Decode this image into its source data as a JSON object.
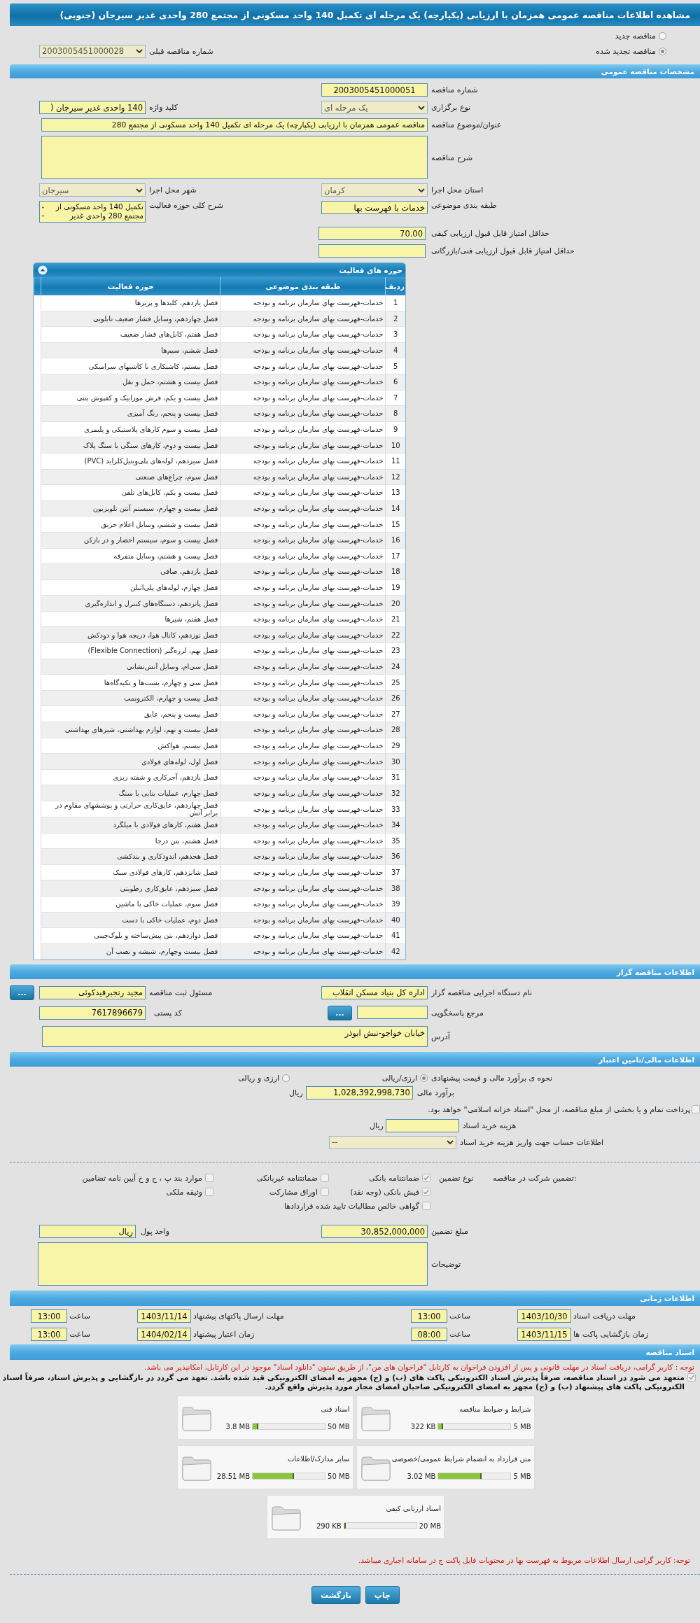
{
  "title": "مشاهده اطلاعات مناقصه عمومی همزمان با ارزیابی (یکپارچه) یک مرحله ای تکمیل 140 واحد مسکونی از مجتمع 280 واحدی غدیر سیرجان (جنوبی)",
  "tender_options": [
    {
      "label": "مناقصه جدید",
      "selected": false
    },
    {
      "label": "مناقصه تجدید شده",
      "selected": true
    }
  ],
  "previous_tender": {
    "label": "شماره مناقصه قبلی",
    "value": "2003005451000028"
  },
  "general": {
    "heading": "مشخصات مناقصه عمومی",
    "tender_number": {
      "label": "شماره مناقصه",
      "value": "2003005451000051"
    },
    "holding_type": {
      "label": "نوع برگزاری",
      "value": "یک مرحله ای"
    },
    "keyword": {
      "label": "کلید واژه",
      "value": "140 واحدی غدیر سیرجان ("
    },
    "subject": {
      "label": "عنوان/موضوع مناقصه",
      "value": "مناقصه عمومی همزمان با ارزیابی (یکپارچه) یک مرحله ای تکمیل 140 واحد مسکونی از مجتمع 280"
    },
    "description": {
      "label": "شرح مناقصه"
    },
    "province": {
      "label": "استان محل اجرا",
      "value": "کرمان"
    },
    "city": {
      "label": "شهر محل اجرا",
      "value": "سیرجان"
    },
    "category": {
      "label": "طبقه بندی موضوعی",
      "value": "خدمات با فهرست بها"
    },
    "activity_summary": {
      "label": "شرح کلی حوزه فعالیت",
      "value": "تکمیل 140 واحد مسکونی از مجتمع 280 واحدی غدیر"
    },
    "min_quality": {
      "label": "حداقل امتیاز قابل قبول ارزیابی کیفی",
      "value": "70.00"
    },
    "min_technical": {
      "label": "حداقل امتیاز قابل قبول ارزیابی فنی/بازرگانی"
    }
  },
  "activities": {
    "heading": "حوزه های فعالیت",
    "columns": [
      "ردیف",
      "طبقه بندی موضوعی",
      "حوزه فعالیت"
    ],
    "rows": [
      {
        "no": "1",
        "category": "خدمات-فهرست بهای سازمان برنامه و بودجه",
        "activity": "فصل یازدهم، کلیدها و پریزها"
      },
      {
        "no": "2",
        "category": "خدمات-فهرست بهای سازمان برنامه و بودجه",
        "activity": "فصل چهاردهم، وسایل فشار ضعیف تابلویی"
      },
      {
        "no": "3",
        "category": "خدمات-فهرست بهای سازمان برنامه و بودجه",
        "activity": "فصل هفتم، کابل‌های فشار ضعیف"
      },
      {
        "no": "4",
        "category": "خدمات-فهرست بهای سازمان برنامه و بودجه",
        "activity": "فصل ششم، سیم‌ها"
      },
      {
        "no": "5",
        "category": "خدمات-فهرست بهای سازمان برنامه و بودجه",
        "activity": "فصل بیستم، کاشیکاری با کاشیهای سرامیکی"
      },
      {
        "no": "6",
        "category": "خدمات-فهرست بهای سازمان برنامه و بودجه",
        "activity": "فصل بیست و هشتم، حمل و نقل"
      },
      {
        "no": "7",
        "category": "خدمات-فهرست بهای سازمان برنامه و بودجه",
        "activity": "فصل بیست و یکم، فرش موزاییک و کفپوش بتنی"
      },
      {
        "no": "8",
        "category": "خدمات-فهرست بهای سازمان برنامه و بودجه",
        "activity": "فصل بیست و پنجم، رنگ آمیزی"
      },
      {
        "no": "9",
        "category": "خدمات-فهرست بهای سازمان برنامه و بودجه",
        "activity": "فصل بیست و سوم کارهای پلاستیکی و پلیمری"
      },
      {
        "no": "10",
        "category": "خدمات-فهرست بهای سازمان برنامه و بودجه",
        "activity": "فصل بیست و دوم، کارهای سنگی با سنگ پلاک"
      },
      {
        "no": "11",
        "category": "خدمات-فهرست بهای سازمان برنامه و بودجه",
        "activity": "فصل سیزدهم، لوله‌های پلی‌وینیل‌کلراید (PVC)"
      },
      {
        "no": "12",
        "category": "خدمات-فهرست بهای سازمان برنامه و بودجه",
        "activity": "فصل سوم، چراغ‌های صنعتی"
      },
      {
        "no": "13",
        "category": "خدمات-فهرست بهای سازمان برنامه و بودجه",
        "activity": "فصل بیست و یکم، کابل‌های تلفن"
      },
      {
        "no": "14",
        "category": "خدمات-فهرست بهای سازمان برنامه و بودجه",
        "activity": "فصل بیست و چهارم، سیستم آنتن تلویزیون"
      },
      {
        "no": "15",
        "category": "خدمات-فهرست بهای سازمان برنامه و بودجه",
        "activity": "فصل بیست و ششم، وسایل اعلام حریق"
      },
      {
        "no": "16",
        "category": "خدمات-فهرست بهای سازمان برنامه و بودجه",
        "activity": "فصل بیست و سوم، سیستم احضار و در بازکن"
      },
      {
        "no": "17",
        "category": "خدمات-فهرست بهای سازمان برنامه و بودجه",
        "activity": "فصل بیست و هشتم، وسایل متفرقه"
      },
      {
        "no": "18",
        "category": "خدمات-فهرست بهای سازمان برنامه و بودجه",
        "activity": "فصل یازدهم، صافی"
      },
      {
        "no": "19",
        "category": "خدمات-فهرست بهای سازمان برنامه و بودجه",
        "activity": "فصل چهارم، لوله‌های پلی‌اتیلن"
      },
      {
        "no": "20",
        "category": "خدمات-فهرست بهای سازمان برنامه و بودجه",
        "activity": "فصل پانزدهم، دستگاه‌های کنترل و اندازه‌گیری"
      },
      {
        "no": "21",
        "category": "خدمات-فهرست بهای سازمان برنامه و بودجه",
        "activity": "فصل هفتم، شیرها"
      },
      {
        "no": "22",
        "category": "خدمات-فهرست بهای سازمان برنامه و بودجه",
        "activity": "فصل نوزدهم، کانال هوا، دریچه هوا و دودکش"
      },
      {
        "no": "23",
        "category": "خدمات-فهرست بهای سازمان برنامه و بودجه",
        "activity": "فصل نهم، لرزه‌گیر (Flexible Connection)"
      },
      {
        "no": "24",
        "category": "خدمات-فهرست بهای سازمان برنامه و بودجه",
        "activity": "فصل سی‌ام، وسایل آتش‌نشانی"
      },
      {
        "no": "25",
        "category": "خدمات-فهرست بهای سازمان برنامه و بودجه",
        "activity": "فصل سی و چهارم، بست‌ها و تکیه‌گاه‌ها"
      },
      {
        "no": "26",
        "category": "خدمات-فهرست بهای سازمان برنامه و بودجه",
        "activity": "فصل بیست و چهارم، الکتروپمپ"
      },
      {
        "no": "27",
        "category": "خدمات-فهرست بهای سازمان برنامه و بودجه",
        "activity": "فصل بیست و پنجم، عایق"
      },
      {
        "no": "28",
        "category": "خدمات-فهرست بهای سازمان برنامه و بودجه",
        "activity": "فصل بیست و نهم، لوازم بهداشتی، شیرهای بهداشتی"
      },
      {
        "no": "29",
        "category": "خدمات-فهرست بهای سازمان برنامه و بودجه",
        "activity": "فصل بیستم، هواکش"
      },
      {
        "no": "30",
        "category": "خدمات-فهرست بهای سازمان برنامه و بودجه",
        "activity": "فصل اول، لوله‌های فولادی"
      },
      {
        "no": "31",
        "category": "خدمات-فهرست بهای سازمان برنامه و بودجه",
        "activity": "فصل یازدهم، آجرکاری و شفته ریزی"
      },
      {
        "no": "32",
        "category": "خدمات-فهرست بهای سازمان برنامه و بودجه",
        "activity": "فصل چهارم، عملیات بنایی با سنگ"
      },
      {
        "no": "33",
        "category": "خدمات-فهرست بهای سازمان برنامه و بودجه",
        "activity": "فصل چهاردهم، عایق‌کاری حرارتی و پوششهای مقاوم در برابر آتش"
      },
      {
        "no": "34",
        "category": "خدمات-فهرست بهای سازمان برنامه و بودجه",
        "activity": "فصل هفتم، کارهای فولادی با میلگرد"
      },
      {
        "no": "35",
        "category": "خدمات-فهرست بهای سازمان برنامه و بودجه",
        "activity": "فصل هشتم، بتن درجا"
      },
      {
        "no": "36",
        "category": "خدمات-فهرست بهای سازمان برنامه و بودجه",
        "activity": "فصل هجدهم، اندودکاری و بندکشی"
      },
      {
        "no": "37",
        "category": "خدمات-فهرست بهای سازمان برنامه و بودجه",
        "activity": "فصل شانزدهم، کارهای فولادی سبک"
      },
      {
        "no": "38",
        "category": "خدمات-فهرست بهای سازمان برنامه و بودجه",
        "activity": "فصل سیزدهم، عایق‌کاری رطوبتی"
      },
      {
        "no": "39",
        "category": "خدمات-فهرست بهای سازمان برنامه و بودجه",
        "activity": "فصل سوم، عملیات خاکی با ماشین"
      },
      {
        "no": "40",
        "category": "خدمات-فهرست بهای سازمان برنامه و بودجه",
        "activity": "فصل دوم، عملیات خاکی با دست"
      },
      {
        "no": "41",
        "category": "خدمات-فهرست بهای سازمان برنامه و بودجه",
        "activity": "فصل دوازدهم، بتن پیش‌ساخته و بلوک‌چینی"
      },
      {
        "no": "42",
        "category": "خدمات-فهرست بهای سازمان برنامه و بودجه",
        "activity": "فصل بیست وچهارم، شیشه و نصب آن"
      }
    ]
  },
  "organizer": {
    "heading": "اطلاعات مناقصه گزار",
    "executive_body": {
      "label": "نام دستگاه اجرایی مناقصه گزار",
      "value": "اداره کل بنیاد مسکن انقلاب"
    },
    "registrar": {
      "label": "مسئول ثبت مناقصه",
      "value": "مجید رنجبرفیدکوئی",
      "button": "..."
    },
    "reference": {
      "label": "مرجع پاسخگویی",
      "button": "..."
    },
    "postal_code": {
      "label": "کد پستی",
      "value": "7617896679"
    },
    "address": {
      "label": "آدرس",
      "value": "خیابان خواجو-نبش ابوذر"
    }
  },
  "financial": {
    "heading": "اطلاعات مالی/تامین اعتبار",
    "estimate_method": {
      "label": "نحوه ی برآورد مالی و قیمت پیشنهادی",
      "options": [
        {
          "label": "ارزی/ریالی",
          "selected": true
        },
        {
          "label": "ارزی و ریالی",
          "selected": false
        }
      ]
    },
    "estimate": {
      "label": "برآورد مالی",
      "value": "1,028,392,998,730",
      "unit": "ریال"
    },
    "treasury": {
      "label": "پرداخت تمام و یا بخشی از مبلغ مناقصه، از محل \"اسناد خزانه اسلامی\" خواهد بود.",
      "checked": false
    },
    "doc_fee": {
      "label": "هزینه خرید اسناد",
      "unit": "ریال"
    },
    "account": {
      "label": "اطلاعات حساب جهت واریز هزینه خرید اسناد",
      "value": "--"
    }
  },
  "guarantee": {
    "label": "تضمین شرکت در مناقصه:",
    "type_label": "نوع تضمین",
    "options": [
      {
        "label": "ضمانتنامه بانکی",
        "checked": true
      },
      {
        "label": "ضمانتنامه غیربانکی",
        "checked": false
      },
      {
        "label": "موارد بند پ ، ح و خ آیین نامه تضامین",
        "checked": false
      },
      {
        "label": "فیش بانکی (وجه نقد)",
        "checked": true
      },
      {
        "label": "اوراق مشارکت",
        "checked": false
      },
      {
        "label": "وثیقه ملکی",
        "checked": false
      },
      {
        "label": "گواهی خالص مطالبات تایید شده قراردادها",
        "checked": false
      }
    ],
    "amount": {
      "label": "مبلغ تضمین",
      "value": "30,852,000,000"
    },
    "currency": {
      "label": "واحد پول",
      "value": "ریال"
    },
    "notes": {
      "label": "توضیحات"
    }
  },
  "schedule": {
    "heading": "اطلاعات زمانی",
    "items": [
      {
        "label": "مهلت دریافت اسناد",
        "date": "1403/10/30",
        "time_label": "ساعت",
        "time": "13:00"
      },
      {
        "label": "مهلت ارسال پاکتهای پیشنهاد",
        "date": "1403/11/14",
        "time_label": "ساعت",
        "time": "13:00"
      },
      {
        "label": "زمان بازگشایی پاکت ها",
        "date": "1403/11/15",
        "time_label": "ساعت",
        "time": "08:00"
      },
      {
        "label": "زمان اعتبار پیشنهاد",
        "date": "1404/02/14",
        "time_label": "ساعت",
        "time": "13:00"
      }
    ]
  },
  "documents": {
    "heading": "اسناد مناقصه",
    "notice": "توجه : کاربر گرامی، دریافت اسناد در مهلت قانونی و پس از افزودن فراخوان به کارتابل \"فراخوان های من\"، از طریق ستون \"دانلود اسناد\" موجود در این کارتابل، امکانپذیر می باشد.",
    "commitment": {
      "checked": true,
      "text": "متعهد می شود در اسناد مناقصه، صرفاً پذیرش اسناد الکترونیکی پاکت های (ب) و (ج) مجهز به امضای الکترونیکی قید شده باشد. تعهد می گردد در بازگشایی و پذیرش اسناد، صرفاً اسناد الکترونیکی پاکت های پیشنهاد (ب) و (ج) مجهز به امضای الکترونیکی صاحبان امضای مجاز مورد پذیرش واقع گردد."
    },
    "files": [
      {
        "name": "شرایط و ضوابط مناقصه",
        "size": "322 KB",
        "max": "5 MB",
        "level": 0.06
      },
      {
        "name": "اسناد فنی",
        "size": "3.8 MB",
        "max": "50 MB",
        "level": 0.08
      },
      {
        "name": "متن قرارداد به انضمام شرایط عمومی/خصوصی",
        "size": "3.02 MB",
        "max": "5 MB",
        "level": 0.6
      },
      {
        "name": "سایر مدارک/اطلاعات",
        "size": "28.51 MB",
        "max": "50 MB",
        "level": 0.57
      },
      {
        "name": "اسناد ارزیابی کیفی",
        "size": "290 KB",
        "max": "20 MB",
        "level": 0.015
      }
    ],
    "footer_note": "توجه: کاربر گرامی ارسال اطلاعات مربوط به فهرست بها در محتویات فایل پاکت ج در سامانه اجباری میباشد."
  },
  "buttons": [
    {
      "label": "چاپ"
    },
    {
      "label": "بازگشت"
    }
  ]
}
